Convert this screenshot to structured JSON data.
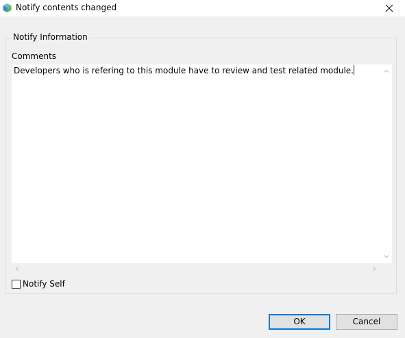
{
  "window": {
    "title": "Notify contents changed",
    "app_icon": "cube-icon",
    "close_icon": "close-icon"
  },
  "group": {
    "legend": "Notify Information",
    "comments_label": "Comments",
    "comments_value": "Developers who is refering to this module have to review and test related module."
  },
  "notify_self": {
    "label": "Notify Self",
    "checked": false
  },
  "buttons": {
    "ok": "OK",
    "cancel": "Cancel"
  },
  "colors": {
    "default_button_border": "#0078d7",
    "dialog_background": "#f0f0f0"
  }
}
